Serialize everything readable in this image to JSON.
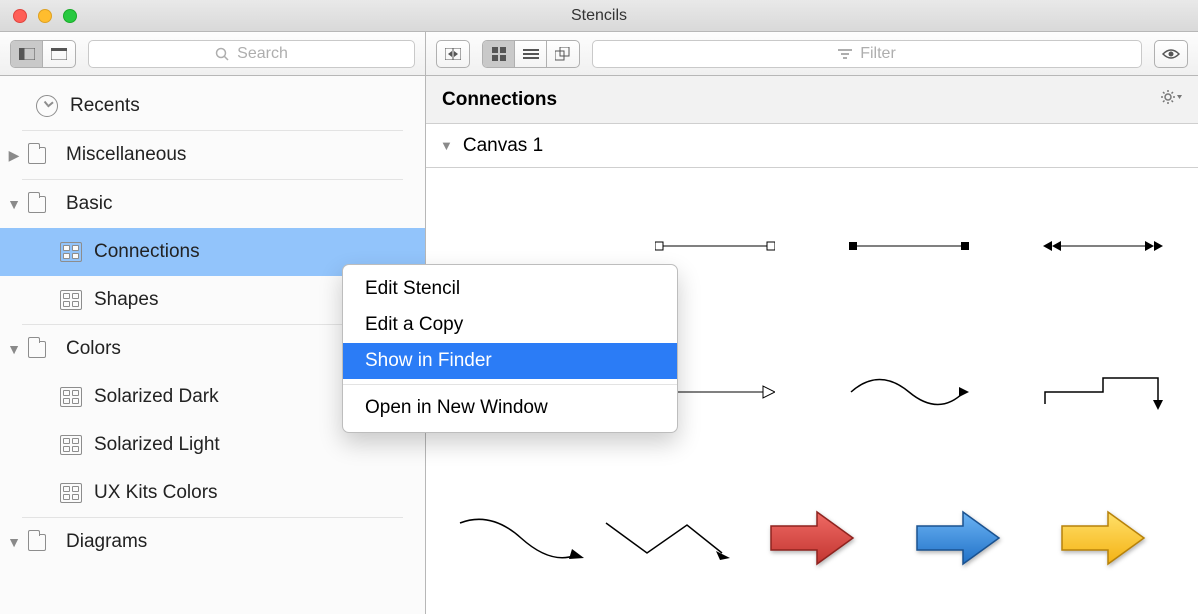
{
  "window_title": "Stencils",
  "sidebar_search_placeholder": "Search",
  "filter_placeholder": "Filter",
  "sidebar": {
    "recents": "Recents",
    "groups": [
      {
        "label": "Miscellaneous",
        "expanded": false,
        "items": []
      },
      {
        "label": "Basic",
        "expanded": true,
        "items": [
          {
            "label": "Connections",
            "selected": true
          },
          {
            "label": "Shapes",
            "selected": false
          }
        ]
      },
      {
        "label": "Colors",
        "expanded": true,
        "items": [
          {
            "label": "Solarized Dark"
          },
          {
            "label": "Solarized Light"
          },
          {
            "label": "UX Kits Colors"
          }
        ]
      },
      {
        "label": "Diagrams",
        "expanded": true,
        "items": []
      }
    ]
  },
  "context_menu": {
    "items": [
      "Edit Stencil",
      "Edit a Copy",
      "Show in Finder",
      "Open in New Window"
    ],
    "highlighted_index": 2
  },
  "main": {
    "title": "Connections",
    "canvas": "Canvas 1"
  }
}
